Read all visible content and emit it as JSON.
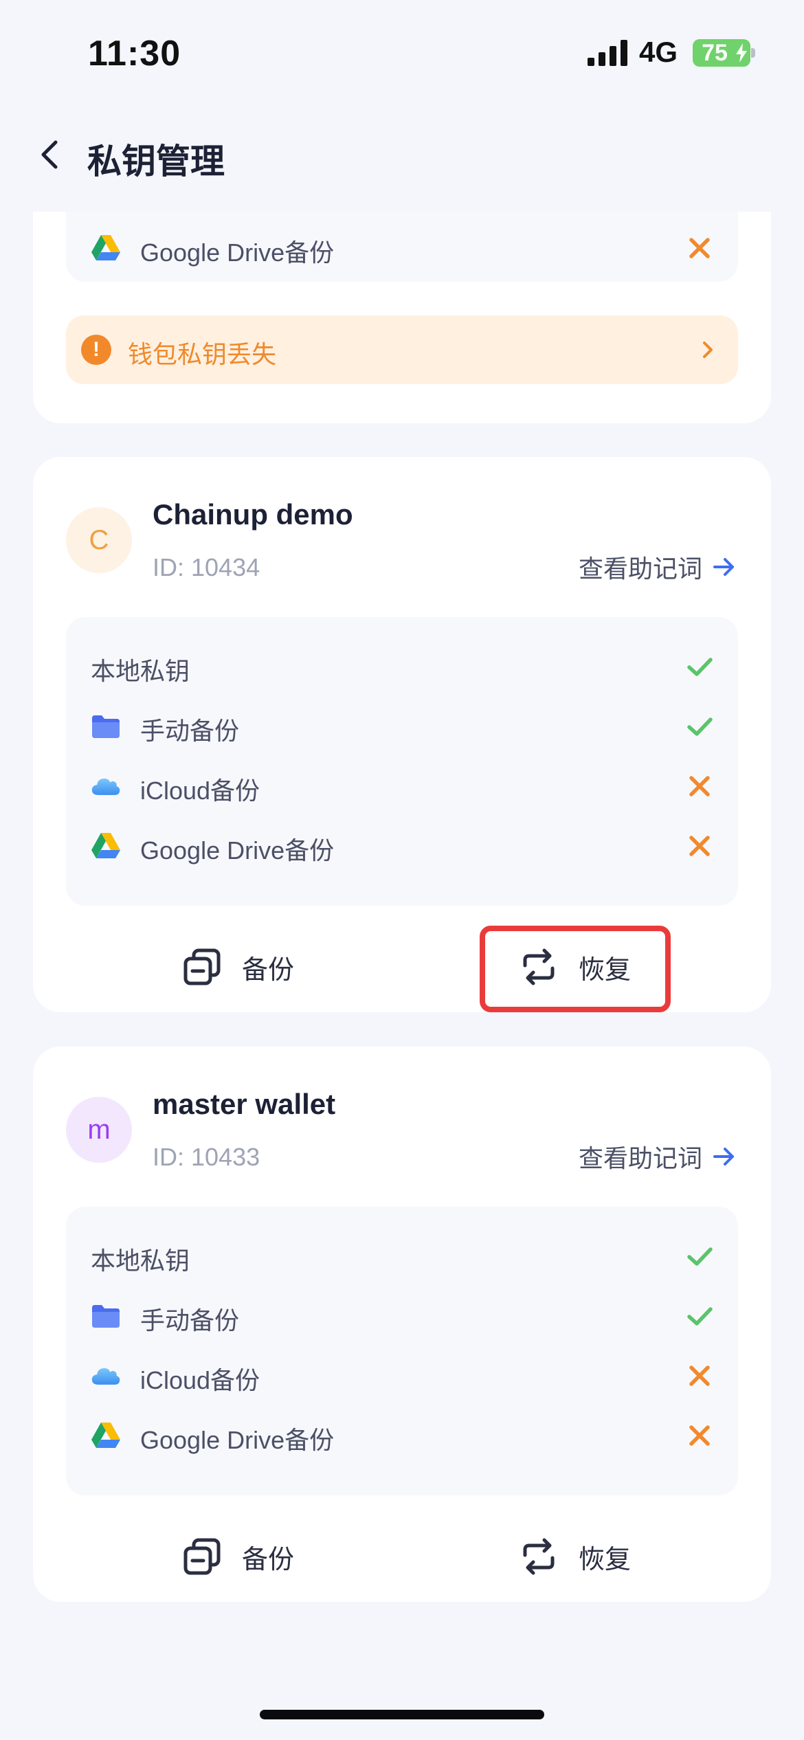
{
  "status_bar": {
    "time": "11:30",
    "network": "4G",
    "battery": "75"
  },
  "header": {
    "title": "私钥管理"
  },
  "top_card": {
    "partial_row": {
      "label": "Google Drive备份",
      "status": "missing",
      "icon": "google-drive-icon"
    },
    "alert": {
      "text": "钱包私钥丢失",
      "icon": "warning-icon"
    }
  },
  "wallets": [
    {
      "avatar_letter": "C",
      "avatar_color": "#f0a040",
      "name": "Chainup demo",
      "id": "ID: 10434",
      "mnemonic_link": "查看助记词",
      "backups": [
        {
          "label": "本地私钥",
          "status": "ok",
          "icon": ""
        },
        {
          "label": "手动备份",
          "status": "ok",
          "icon": "folder-icon"
        },
        {
          "label": "iCloud备份",
          "status": "missing",
          "icon": "icloud-icon"
        },
        {
          "label": "Google Drive备份",
          "status": "missing",
          "icon": "google-drive-icon"
        }
      ],
      "actions": {
        "backup": "备份",
        "restore": "恢复"
      }
    },
    {
      "avatar_letter": "m",
      "avatar_color": "#9a3ef0",
      "name": "master wallet",
      "id": "ID: 10433",
      "mnemonic_link": "查看助记词",
      "backups": [
        {
          "label": "本地私钥",
          "status": "ok",
          "icon": ""
        },
        {
          "label": "手动备份",
          "status": "ok",
          "icon": "folder-icon"
        },
        {
          "label": "iCloud备份",
          "status": "missing",
          "icon": "icloud-icon"
        },
        {
          "label": "Google Drive备份",
          "status": "missing",
          "icon": "google-drive-icon"
        }
      ],
      "actions": {
        "backup": "备份",
        "restore": "恢复"
      }
    }
  ],
  "colors": {
    "ok": "#5ac46a",
    "missing": "#f08a2e",
    "link_arrow": "#3d6ef0",
    "highlight": "#ea3b3b"
  }
}
